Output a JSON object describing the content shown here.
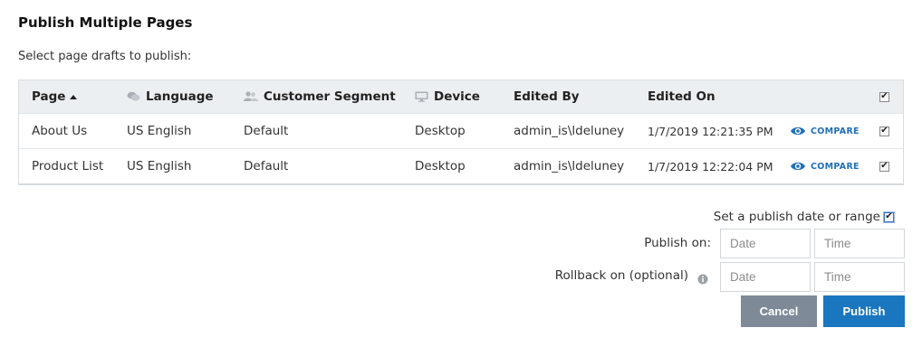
{
  "dialog": {
    "title": "Publish Multiple Pages",
    "subtitle": "Select page drafts to publish:"
  },
  "table": {
    "headers": {
      "page": "Page",
      "language": "Language",
      "segment": "Customer Segment",
      "device": "Device",
      "edited_by": "Edited By",
      "edited_on": "Edited On"
    },
    "rows": [
      {
        "page": "About Us",
        "language": "US English",
        "segment": "Default",
        "device": "Desktop",
        "edited_by": "admin_is\\ldeluney",
        "edited_on": "1/7/2019 12:21:35 PM",
        "compare": "COMPARE",
        "selected": true
      },
      {
        "page": "Product List",
        "language": "US English",
        "segment": "Default",
        "device": "Desktop",
        "edited_by": "admin_is\\ldeluney",
        "edited_on": "1/7/2019 12:22:04 PM",
        "compare": "COMPARE",
        "selected": true
      }
    ],
    "select_all": true
  },
  "schedule": {
    "range_label": "Set a publish date or range",
    "range_checked": true,
    "publish_on_label": "Publish on:",
    "rollback_label": "Rollback on (optional)",
    "date_placeholder": "Date",
    "time_placeholder": "Time"
  },
  "buttons": {
    "cancel": "Cancel",
    "publish": "Publish"
  },
  "colors": {
    "accent": "#1976bf",
    "cancel_bg": "#7e8a97",
    "header_bg": "#eceff2"
  },
  "icons": {
    "sort": "sort-ascending-icon",
    "language": "chat-bubbles-icon",
    "segment": "users-icon",
    "device": "monitor-icon",
    "compare": "eye-icon",
    "info": "info-icon"
  }
}
